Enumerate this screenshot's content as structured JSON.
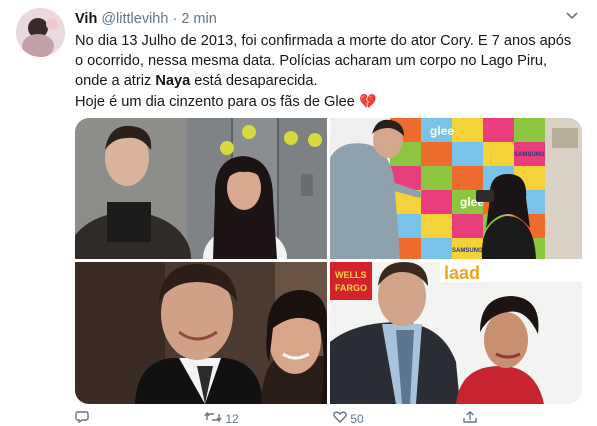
{
  "tweet": {
    "author_name": "Vih",
    "handle": "@littlevihh",
    "separator": "·",
    "time": "2 min",
    "line1": "No dia 13 Julho de 2013, foi confirmada a morte do ator Cory. E 7 anos após",
    "line2": "o ocorrido, nessa mesma data. Polícias acharam um corpo no Lago Piru,",
    "line3_pre": "onde a atriz ",
    "line3_bold": "Naya",
    "line3_post": " está desaparecida.",
    "line4": "Hoje é um dia cinzento para os fãs de Glee",
    "line4_emoji": "💔"
  },
  "photo_text": {
    "glee_1": "glee",
    "glee_2": "glee",
    "sponsor_1": "SAMSUNG",
    "sponsor_2": "SAMSUNG",
    "wells": "WELLS",
    "fargo": "FARGO",
    "glaad": "laad"
  },
  "actions": {
    "reply_icon": "reply-icon",
    "reply_count": "",
    "retweet_icon": "retweet-icon",
    "retweet_count": "12",
    "like_icon": "heart-icon",
    "like_count": "50",
    "share_icon": "share-icon"
  },
  "colors": {
    "text": "#14171a",
    "muted": "#657786",
    "link_accent": "#1da1f2",
    "heart": "#d4183f"
  }
}
